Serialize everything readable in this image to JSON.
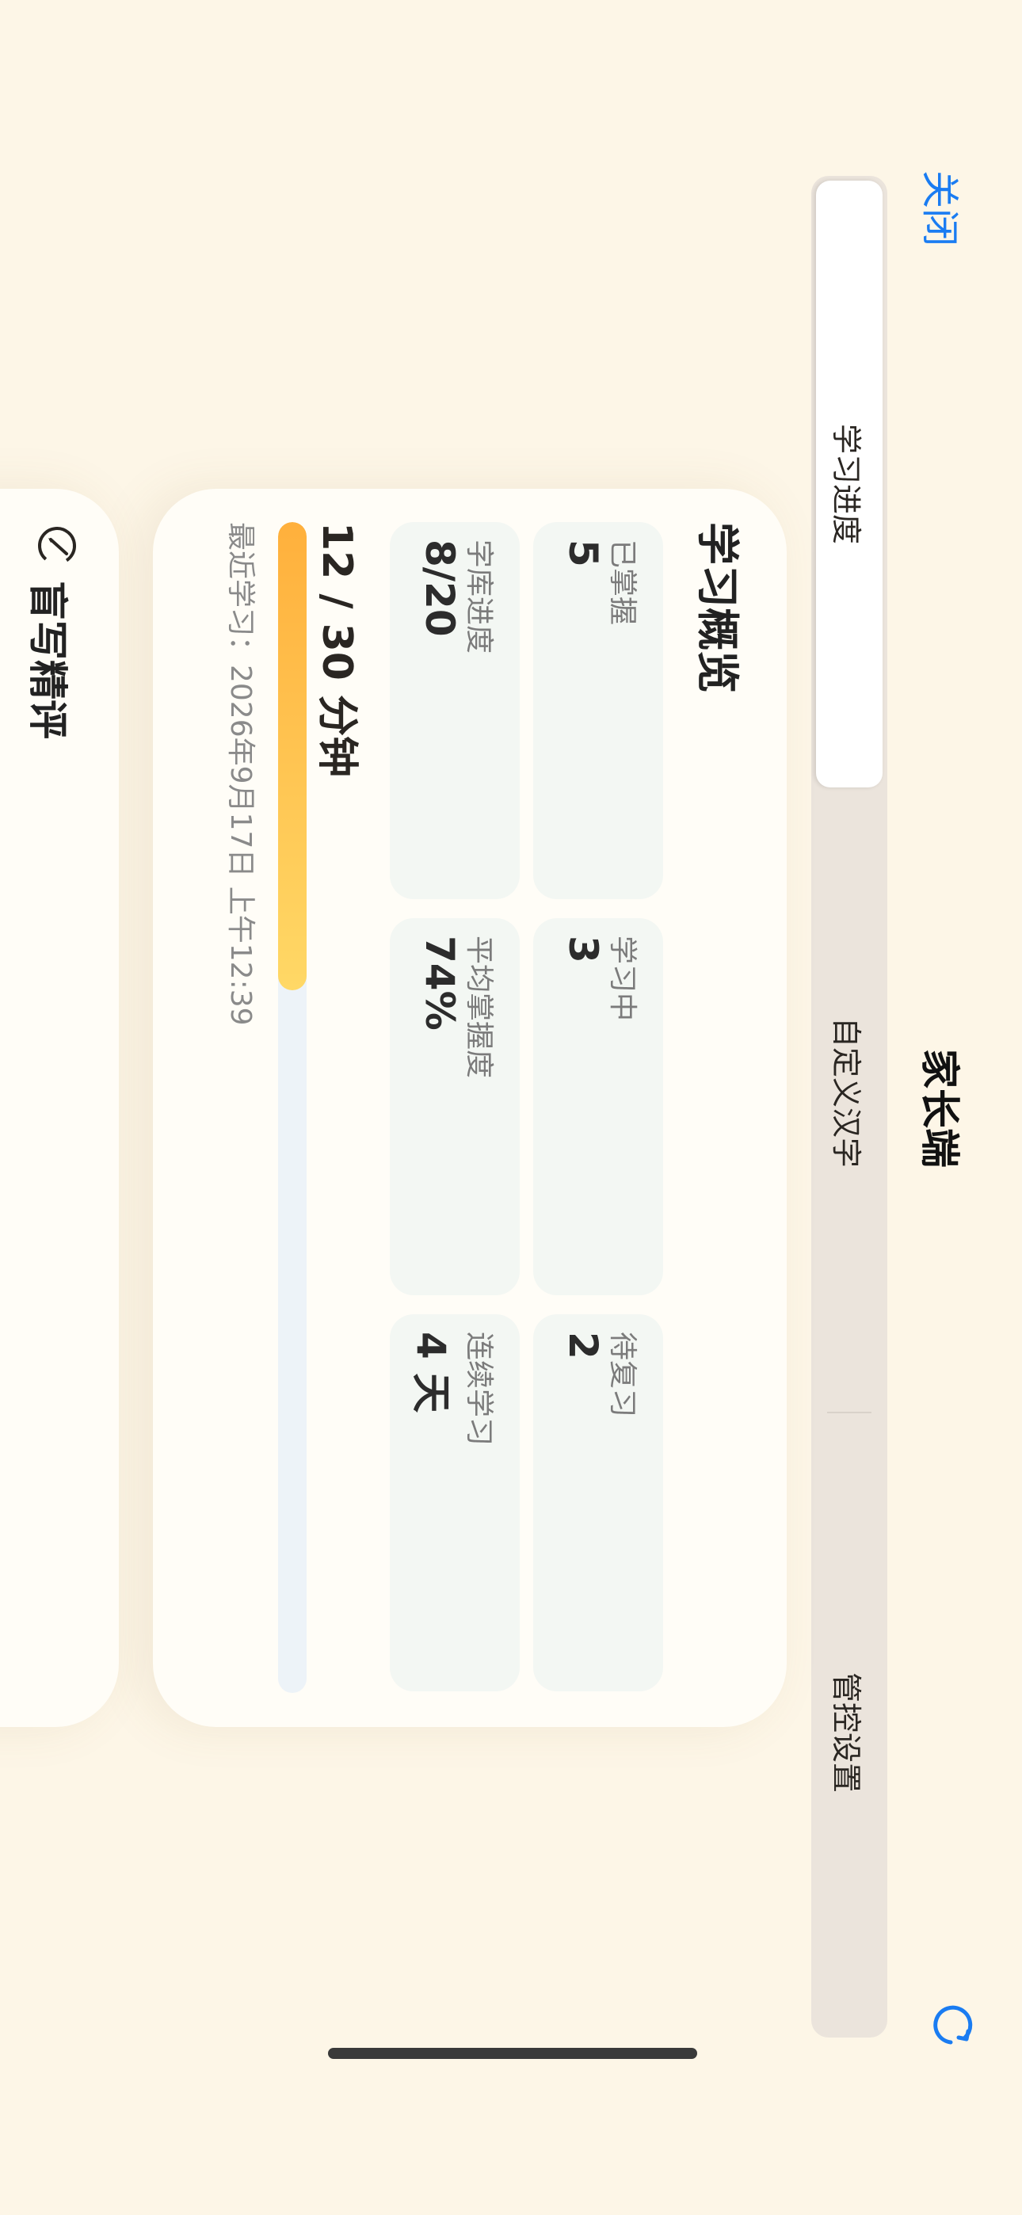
{
  "nav": {
    "close_label": "关闭",
    "title": "家长端",
    "refresh_icon": "refresh-icon"
  },
  "tabs": [
    {
      "label": "学习进度",
      "selected": true
    },
    {
      "label": "自定义汉字",
      "selected": false
    },
    {
      "label": "管控设置",
      "selected": false
    }
  ],
  "overview": {
    "title": "学习概览",
    "stats": [
      {
        "label": "已掌握",
        "value": "5"
      },
      {
        "label": "学习中",
        "value": "3"
      },
      {
        "label": "待复习",
        "value": "2"
      },
      {
        "label": "字库进度",
        "value": "8/20"
      },
      {
        "label": "平均掌握度",
        "value": "74%"
      },
      {
        "label": "连续学习",
        "value": "4 天"
      }
    ],
    "minutes_text": "12 / 30 分钟",
    "minutes_progress": 0.4,
    "last_study": "最近学习：2026年9月17日 上午12:39"
  },
  "dictation": {
    "title": "盲写精评",
    "icon": "pen-check-icon"
  },
  "colors": {
    "accent_blue": "#1a7cf2",
    "background": "#fdf6e7",
    "progress_start": "#ffb03c",
    "progress_end": "#ffd866"
  }
}
